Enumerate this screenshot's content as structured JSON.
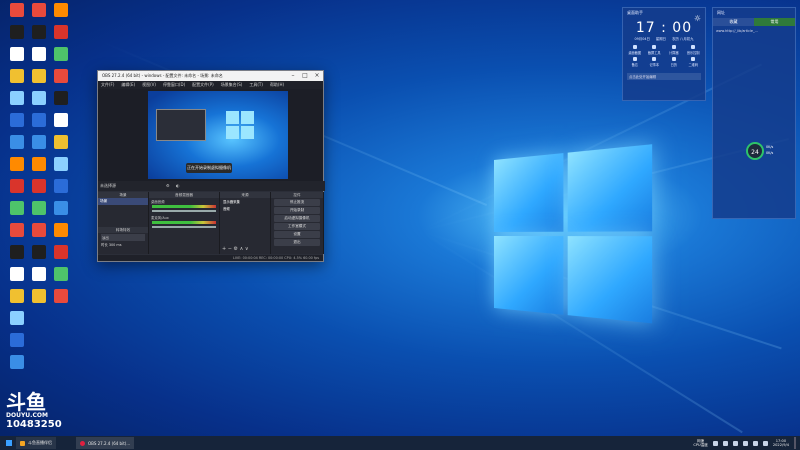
{
  "desktop": {
    "icon_count": 60,
    "watermark": {
      "logo": "斗鱼",
      "domain": "DOUYU.COM",
      "room_id": "10483250"
    }
  },
  "obs_window": {
    "title": "OBS 27.2.4 (64 bit) - windows - 配置文件: 未命名 - 场景: 未命名",
    "menu": [
      "文件(F)",
      "编辑(E)",
      "视图(V)",
      "停靠窗口(D)",
      "配置文件(P)",
      "场景集合(S)",
      "工具(T)",
      "帮助(H)"
    ],
    "toast": "正在开始录制虚拟摄像机",
    "source_bar": "未选择源",
    "docks": {
      "scenes": {
        "title": "场景",
        "items": [
          "场景"
        ]
      },
      "sources": {
        "title": "来源",
        "items": [
          "显示器采集",
          "音频"
        ]
      },
      "mixer": {
        "title": "音频混音器",
        "channels": [
          "桌面音频",
          "麦克风/Aux"
        ]
      },
      "transitions": {
        "title": "转场特效",
        "type": "淡出",
        "duration_label": "时长",
        "duration": "300 ms"
      },
      "controls": {
        "title": "控件",
        "buttons": [
          "停止推流",
          "开始录制",
          "启动虚拟摄像机",
          "工作室模式",
          "设置",
          "退出"
        ]
      }
    },
    "status": "LIVE: 00:00:04   REC: 00:00:00   CPU: 4.5%   60.00 fps"
  },
  "clock_panel": {
    "title": "桌面助手",
    "time": "17 : 00",
    "date": [
      "09月04日",
      "星期日",
      "农历 八月初九"
    ],
    "actions": [
      "桌面截图",
      "截屏工具",
      "计算器",
      "音乐控制",
      "备忘",
      "记事本",
      "日历",
      "二维码"
    ],
    "footer": "点击此处开始编辑"
  },
  "side_panel": {
    "title": "网址",
    "tabs": [
      "收藏",
      "常用"
    ],
    "url": "www.http://_lib/article_..."
  },
  "net_widget": {
    "percent": "24",
    "up": "0K/s",
    "down": "0K/s"
  },
  "taskbar": {
    "apps": [
      {
        "label": "斗鱼直播伴侣",
        "color": "#f5a623"
      },
      {
        "label": "OBS 27.2.4 (64 bit)...",
        "color": "#e02040"
      }
    ],
    "tray_text_top": "网速",
    "tray_text_bottom": "CPU温度",
    "time": "17:00",
    "date": "2022/9/4"
  }
}
